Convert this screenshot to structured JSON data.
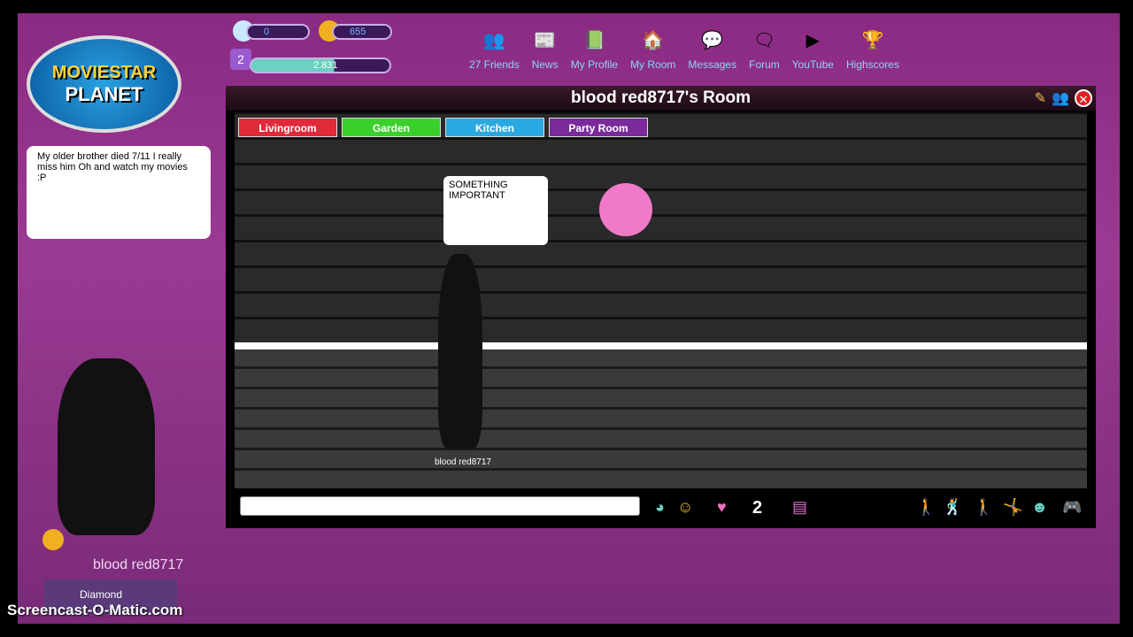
{
  "logo": {
    "line1": "MOVIESTAR",
    "line2": "PLANET"
  },
  "stats": {
    "diamonds": "0",
    "coins": "655",
    "level": "2",
    "fame": "2.831"
  },
  "nav": [
    {
      "label": "27 Friends",
      "icon": "friends-icon",
      "glyph": "👥"
    },
    {
      "label": "News",
      "icon": "news-icon",
      "glyph": "📰"
    },
    {
      "label": "My Profile",
      "icon": "profile-icon",
      "glyph": "📗"
    },
    {
      "label": "My Room",
      "icon": "house-icon",
      "glyph": "🏠"
    },
    {
      "label": "Messages",
      "icon": "messages-icon",
      "glyph": "💬"
    },
    {
      "label": "Forum",
      "icon": "forum-icon",
      "glyph": "🗨"
    },
    {
      "label": "YouTube",
      "icon": "youtube-icon",
      "glyph": "▶"
    },
    {
      "label": "Highscores",
      "icon": "trophy-icon",
      "glyph": "🏆"
    }
  ],
  "room": {
    "title": "blood red8717's Room",
    "tabs": [
      {
        "label": "Livingroom",
        "color": "#e02a3a"
      },
      {
        "label": "Garden",
        "color": "#3ad02a"
      },
      {
        "label": "Kitchen",
        "color": "#2aa8e0"
      },
      {
        "label": "Party Room",
        "color": "#7a2a9a"
      }
    ],
    "speech": "SOMETHING IMPORTANT",
    "avatar_name": "blood red8717",
    "love_count": "2"
  },
  "side": {
    "message": "My older brother died 7/11 I really miss him Oh and watch my movies :P",
    "username": "blood red8717",
    "vip_label": "Diamond"
  },
  "watermark": "Screencast-O-Matic.com"
}
